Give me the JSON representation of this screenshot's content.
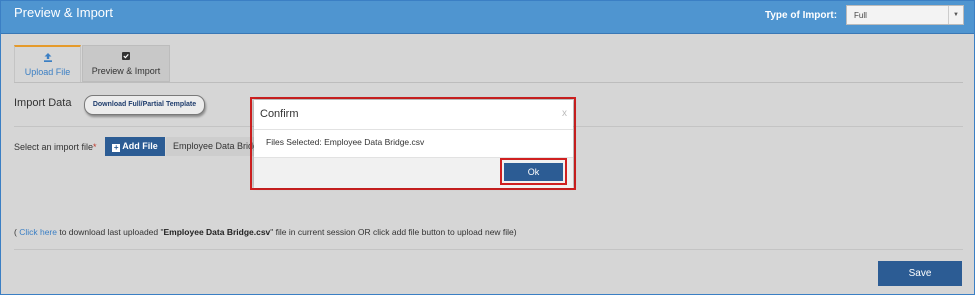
{
  "header": {
    "title": "Preview & Import",
    "import_type_label": "Type of Import:",
    "import_type_value": "Full"
  },
  "tabs": [
    {
      "label": "Upload File",
      "icon": "upload-icon",
      "active": true
    },
    {
      "label": "Preview & Import",
      "icon": "checkbox-icon",
      "active": false
    }
  ],
  "import": {
    "section_title": "Import Data",
    "template_button": "Download Full/Partial Template",
    "select_label": "Select an import file",
    "required_marker": "*",
    "add_file_button": "Add File",
    "file_name": "Employee Data Bridge.csv"
  },
  "info": {
    "prefix": "( ",
    "link_text": "Click here",
    "middle": " to download last uploaded \"",
    "file_name": "Employee Data Bridge.csv",
    "suffix": "\" file in current session OR click add file button to upload new file)"
  },
  "save_button": "Save",
  "modal": {
    "title": "Confirm",
    "close": "x",
    "message": "Files Selected: Employee Data Bridge.csv",
    "ok_button": "Ok"
  },
  "colors": {
    "header": "#4f95d0",
    "primary_button": "#2c5c94",
    "highlight": "#d02020",
    "active_tab_accent": "#e59a2b"
  }
}
